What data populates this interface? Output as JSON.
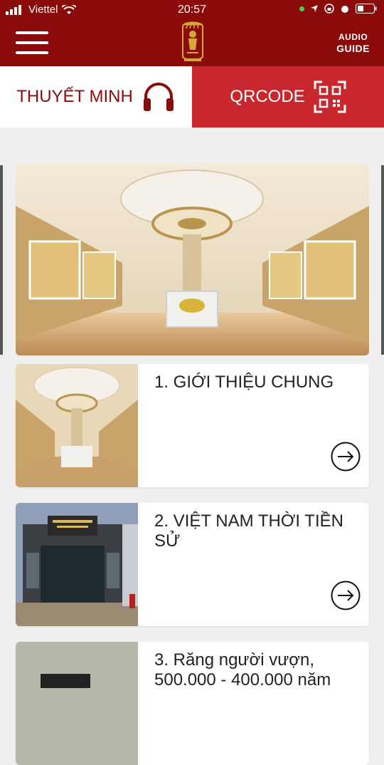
{
  "status": {
    "carrier": "Viettel",
    "time": "20:57"
  },
  "header": {
    "audio_label": "AUDIO",
    "guide_label": "GUIDE"
  },
  "tabs": [
    {
      "label": "THUYẾT MINH"
    },
    {
      "label": "QRCODE"
    }
  ],
  "sections": [
    {
      "title": "1. GIỚI THIỆU CHUNG"
    },
    {
      "title": "2. VIỆT NAM THỜI TIỀN SỬ"
    },
    {
      "title": "3. Răng người vượn, 500.000 - 400.000 năm"
    }
  ],
  "icons": {
    "menu": "hamburger-icon",
    "logo": "museum-logo",
    "headphones": "headphones-icon",
    "qr": "qr-code-icon",
    "arrow": "arrow-right-circle-icon"
  },
  "colors": {
    "header_bg": "#8b0b0b",
    "qr_tab_bg": "#c8272d",
    "page_bg": "#efefef"
  }
}
